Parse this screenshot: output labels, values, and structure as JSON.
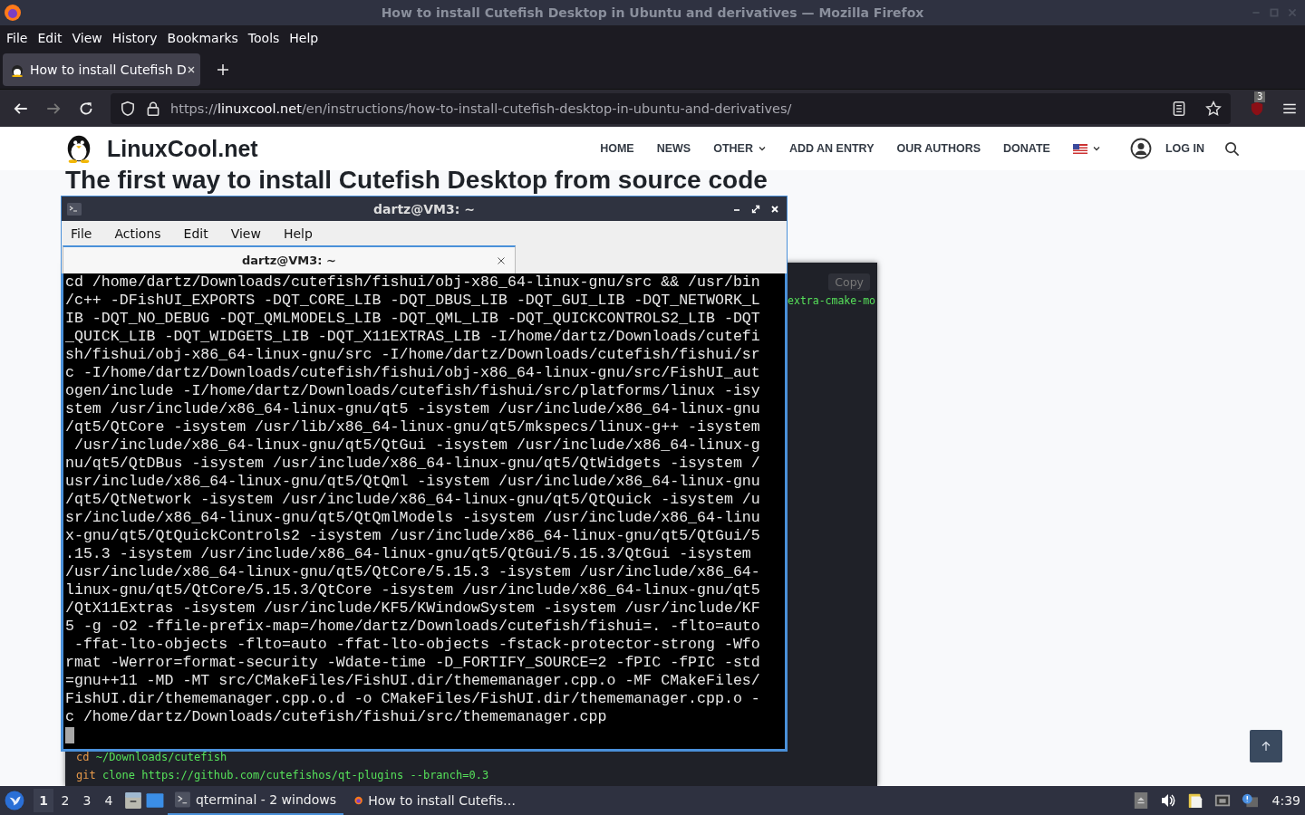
{
  "browser": {
    "title": "How to install Cutefish Desktop in Ubuntu and derivatives — Mozilla Firefox",
    "menu": [
      "File",
      "Edit",
      "View",
      "History",
      "Bookmarks",
      "Tools",
      "Help"
    ],
    "tabs": [
      {
        "label": "How to install Cutefish D",
        "selected": true
      }
    ],
    "url": {
      "scheme": "https://",
      "domain": "linuxcool.net",
      "path": "/en/instructions/how-to-install-cutefish-desktop-in-ubuntu-and-derivatives/"
    },
    "extension_badge": "3"
  },
  "site": {
    "logo": "LinuxCool.net",
    "nav": [
      {
        "label": "HOME",
        "dropdown": false
      },
      {
        "label": "NEWS",
        "dropdown": false
      },
      {
        "label": "OTHER",
        "dropdown": true
      },
      {
        "label": "ADD AN ENTRY",
        "dropdown": false
      },
      {
        "label": "OUR AUTHORS",
        "dropdown": false
      },
      {
        "label": "DONATE",
        "dropdown": false
      }
    ],
    "login": "LOG IN",
    "heading": "The first way to install Cutefish Desktop from source code",
    "code_block": {
      "copy": "Copy",
      "fragment": "extra-cmake-mo",
      "lines": [
        {
          "command": "cd",
          "args": "~/Downloads/cutefish"
        },
        {
          "command": "git",
          "args": "clone https://github.com/cutefishos/qt-plugins --branch=0.3"
        }
      ]
    }
  },
  "terminal": {
    "title": "dartz@VM3: ~",
    "menu": [
      "File",
      "Actions",
      "Edit",
      "View",
      "Help"
    ],
    "tab": "dartz@VM3: ~",
    "lines": [
      "cd /home/dartz/Downloads/cutefish/fishui/obj-x86_64-linux-gnu/src && /usr/bin",
      "/c++ -DFishUI_EXPORTS -DQT_CORE_LIB -DQT_DBUS_LIB -DQT_GUI_LIB -DQT_NETWORK_L",
      "IB -DQT_NO_DEBUG -DQT_QMLMODELS_LIB -DQT_QML_LIB -DQT_QUICKCONTROLS2_LIB -DQT",
      "_QUICK_LIB -DQT_WIDGETS_LIB -DQT_X11EXTRAS_LIB -I/home/dartz/Downloads/cutefi",
      "sh/fishui/obj-x86_64-linux-gnu/src -I/home/dartz/Downloads/cutefish/fishui/sr",
      "c -I/home/dartz/Downloads/cutefish/fishui/obj-x86_64-linux-gnu/src/FishUI_aut",
      "ogen/include -I/home/dartz/Downloads/cutefish/fishui/src/platforms/linux -isy",
      "stem /usr/include/x86_64-linux-gnu/qt5 -isystem /usr/include/x86_64-linux-gnu",
      "/qt5/QtCore -isystem /usr/lib/x86_64-linux-gnu/qt5/mkspecs/linux-g++ -isystem",
      " /usr/include/x86_64-linux-gnu/qt5/QtGui -isystem /usr/include/x86_64-linux-g",
      "nu/qt5/QtDBus -isystem /usr/include/x86_64-linux-gnu/qt5/QtWidgets -isystem /",
      "usr/include/x86_64-linux-gnu/qt5/QtQml -isystem /usr/include/x86_64-linux-gnu",
      "/qt5/QtNetwork -isystem /usr/include/x86_64-linux-gnu/qt5/QtQuick -isystem /u",
      "sr/include/x86_64-linux-gnu/qt5/QtQmlModels -isystem /usr/include/x86_64-linu",
      "x-gnu/qt5/QtQuickControls2 -isystem /usr/include/x86_64-linux-gnu/qt5/QtGui/5",
      ".15.3 -isystem /usr/include/x86_64-linux-gnu/qt5/QtGui/5.15.3/QtGui -isystem",
      "/usr/include/x86_64-linux-gnu/qt5/QtCore/5.15.3 -isystem /usr/include/x86_64-",
      "linux-gnu/qt5/QtCore/5.15.3/QtCore -isystem /usr/include/x86_64-linux-gnu/qt5",
      "/QtX11Extras -isystem /usr/include/KF5/KWindowSystem -isystem /usr/include/KF",
      "5 -g -O2 -ffile-prefix-map=/home/dartz/Downloads/cutefish/fishui=. -flto=auto",
      " -ffat-lto-objects -flto=auto -ffat-lto-objects -fstack-protector-strong -Wfo",
      "rmat -Werror=format-security -Wdate-time -D_FORTIFY_SOURCE=2 -fPIC -fPIC -std",
      "=gnu++11 -MD -MT src/CMakeFiles/FishUI.dir/thememanager.cpp.o -MF CMakeFiles/",
      "FishUI.dir/thememanager.cpp.o.d -o CMakeFiles/FishUI.dir/thememanager.cpp.o -",
      "c /home/dartz/Downloads/cutefish/fishui/src/thememanager.cpp"
    ]
  },
  "taskbar": {
    "workspaces": [
      {
        "label": "1",
        "selected": true
      },
      {
        "label": "2",
        "selected": false
      },
      {
        "label": "3",
        "selected": false
      },
      {
        "label": "4",
        "selected": false
      }
    ],
    "tasks": [
      {
        "label": "qterminal - 2 windows",
        "kind": "terminal",
        "selected": true
      },
      {
        "label": "How to install Cutefis…",
        "kind": "browser",
        "selected": false
      }
    ],
    "clock": "4:39"
  }
}
